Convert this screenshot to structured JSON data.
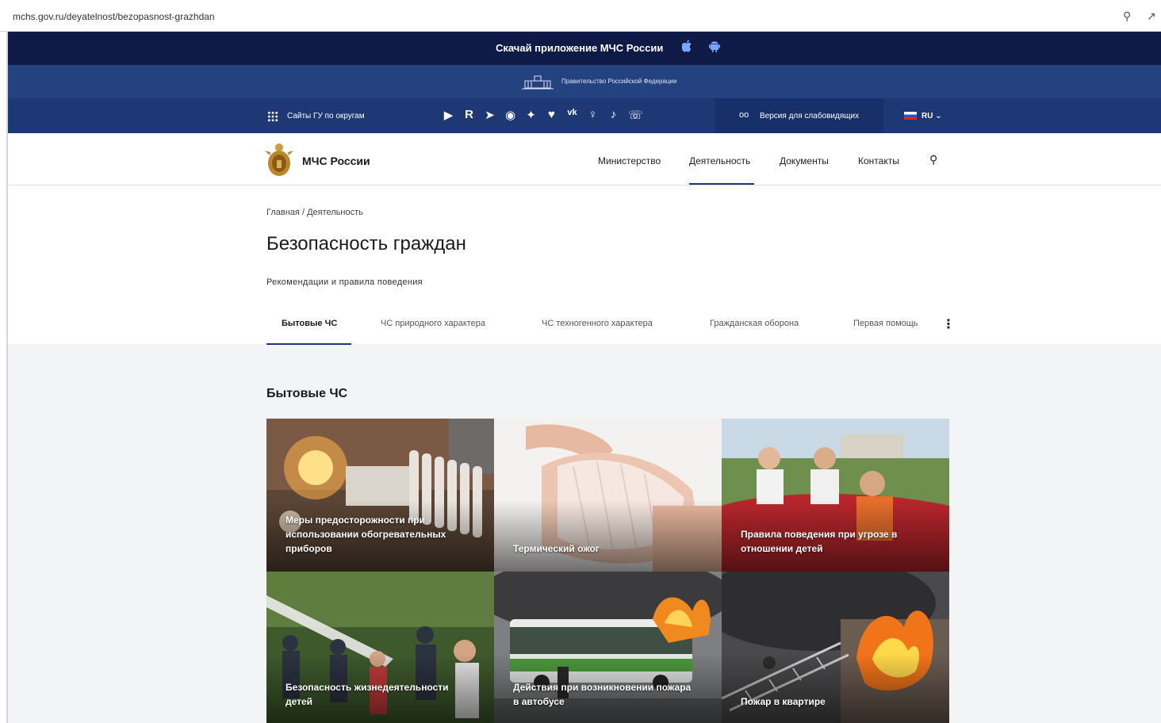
{
  "browser": {
    "url": "mchs.gov.ru/deyatelnost/bezopasnost-grazhdan",
    "zoom_icon": "zoom-out-icon",
    "share_icon": "share-icon"
  },
  "promo_bar": {
    "text": "Скачай приложение МЧС России",
    "icons": [
      "apple-icon",
      "android-icon"
    ]
  },
  "gov_bar": {
    "text": "Правительство Российской Федерации"
  },
  "top_bar": {
    "sites_label": "Сайты ГУ по округам",
    "social_icons": [
      "youtube-icon",
      "rutube-icon",
      "telegram-icon",
      "ok-icon",
      "twitter-icon",
      "heart-icon",
      "vk-icon",
      "odnoklassniki-icon",
      "tiktok-icon",
      "viber-icon"
    ],
    "vision_label": "Версия для слабовидящих",
    "language": "RU"
  },
  "header": {
    "brand": "МЧС России",
    "nav": [
      "Министерство",
      "Деятельность",
      "Документы",
      "Контакты"
    ],
    "active_nav": "Деятельность"
  },
  "breadcrumbs": {
    "home": "Главная",
    "separator": "/",
    "current": "Деятельность"
  },
  "page": {
    "title": "Безопасность граждан",
    "subtitle": "Рекомендации и правила поведения"
  },
  "tabs": {
    "items": [
      "Бытовые ЧС",
      "ЧС природного характера",
      "ЧС техногенного характера",
      "Гражданская оборона",
      "Первая помощь"
    ],
    "active": "Бытовые ЧС",
    "more_icon": "more-vertical-icon"
  },
  "section": {
    "title": "Бытовые ЧС",
    "cards": [
      {
        "caption": "Меры предосторожности при использовании обогревательных приборов"
      },
      {
        "caption": "Термический ожог"
      },
      {
        "caption": "Правила поведения при угрозе в отношении детей"
      },
      {
        "caption": "Безопасность жизнедеятельности детей"
      },
      {
        "caption": "Действия при возникновении пожара в автобусе"
      },
      {
        "caption": "Пожар в квартире"
      }
    ]
  }
}
